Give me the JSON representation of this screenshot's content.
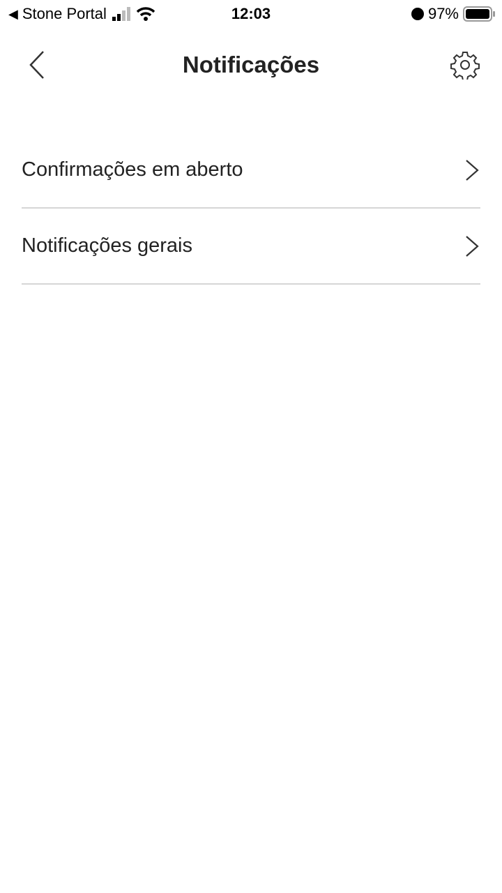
{
  "status_bar": {
    "back_app": "Stone Portal",
    "time": "12:03",
    "battery": "97%",
    "battery_level": 0.97
  },
  "header": {
    "title": "Notificações"
  },
  "list": [
    {
      "label": "Confirmações em aberto"
    },
    {
      "label": "Notificações gerais"
    }
  ]
}
